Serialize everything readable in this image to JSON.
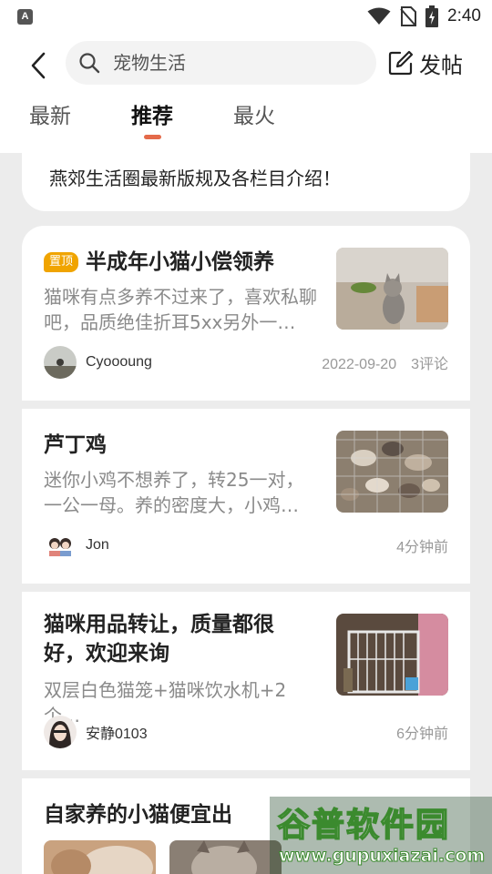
{
  "status_bar": {
    "app_icon_letter": "A",
    "time": "2:40"
  },
  "header": {
    "search_placeholder": "宠物生活",
    "post_label": "发帖",
    "tabs": [
      {
        "label": "最新",
        "active": false
      },
      {
        "label": "推荐",
        "active": true
      },
      {
        "label": "最火",
        "active": false
      }
    ]
  },
  "notice": {
    "text": "燕郊生活圈最新版规及各栏目介绍！"
  },
  "posts": [
    {
      "pinned_label": "置顶",
      "title": "半成年小猫小偿领养",
      "desc": "猫咪有点多养不过来了，喜欢私聊吧，品质绝佳折耳5xx另外一…",
      "author": "Cyoooung",
      "date": "2022-09-20",
      "comments": "3评论"
    },
    {
      "title": "芦丁鸡",
      "desc": "迷你小鸡不想养了，转25一对，一公一母。养的密度大，小鸡…",
      "author": "Jon",
      "time_ago": "4分钟前"
    },
    {
      "title": "猫咪用品转让，质量都很好，欢迎来询",
      "desc": "双层白色猫笼+猫咪饮水机+2个…",
      "author": "安静0103",
      "time_ago": "6分钟前"
    },
    {
      "title": "自家养的小猫便宜出"
    }
  ],
  "watermark": {
    "title": "谷普软件园",
    "url": "www.gupuxiazai.com"
  }
}
